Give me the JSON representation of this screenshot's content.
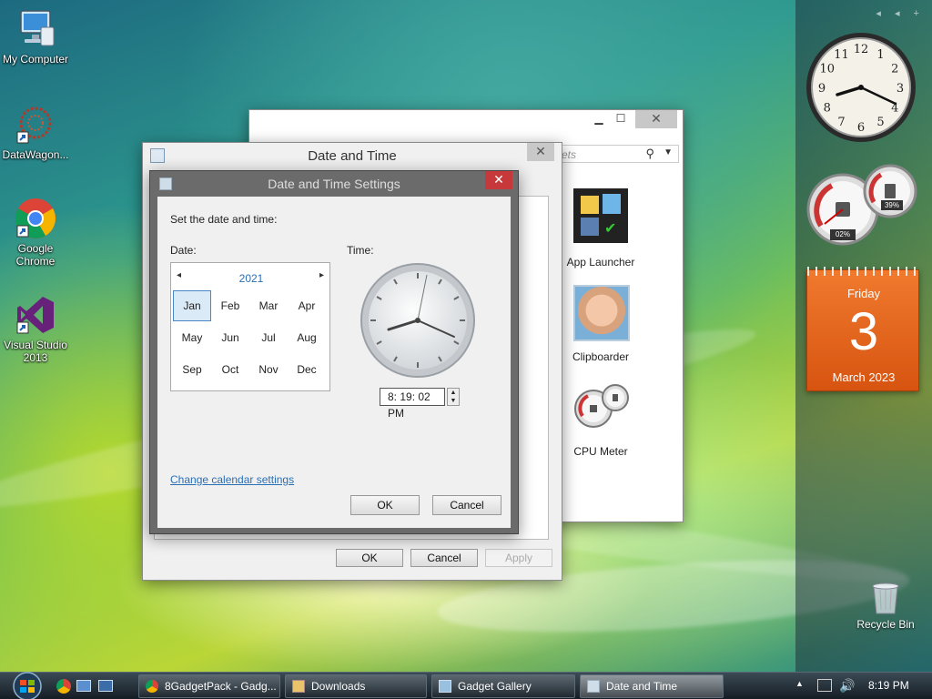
{
  "desktop": {
    "icons": [
      {
        "label": "My Computer"
      },
      {
        "label": "DataWagon..."
      },
      {
        "label": "Google Chrome"
      },
      {
        "label": "Visual Studio 2013"
      },
      {
        "label": "Recycle Bin"
      }
    ]
  },
  "sidebar": {
    "arrows": "◂ ◂ +",
    "clock_numbers": [
      "12",
      "1",
      "2",
      "3",
      "4",
      "5",
      "6",
      "7",
      "8",
      "9",
      "10",
      "11"
    ],
    "cpu_meter": {
      "cpu_value": "02%",
      "mem_value": "39%"
    },
    "calendar": {
      "weekday": "Friday",
      "day": "3",
      "month_year": "March 2023"
    }
  },
  "gadget_window": {
    "search_placeholder": "ets",
    "gadgets": [
      {
        "label": "App Launcher"
      },
      {
        "label": "Clipboarder"
      },
      {
        "label": "CPU Meter"
      }
    ]
  },
  "date_time_window": {
    "title": "Date and Time",
    "buttons": {
      "ok": "OK",
      "cancel": "Cancel",
      "apply": "Apply"
    }
  },
  "settings_dialog": {
    "title": "Date and Time Settings",
    "instruction": "Set the date and time:",
    "date_label": "Date:",
    "time_label": "Time:",
    "year": "2021",
    "prev_arrow": "◂",
    "next_arrow": "▸",
    "months": [
      "Jan",
      "Feb",
      "Mar",
      "Apr",
      "May",
      "Jun",
      "Jul",
      "Aug",
      "Sep",
      "Oct",
      "Nov",
      "Dec"
    ],
    "selected_month": "Jan",
    "time_value": "8: 19: 02 PM",
    "change_calendar_link": "Change calendar settings",
    "ok_label": "OK",
    "cancel_label": "Cancel"
  },
  "taskbar": {
    "tasks": [
      {
        "label": "8GadgetPack - Gadg..."
      },
      {
        "label": "Downloads"
      },
      {
        "label": "Gadget Gallery"
      },
      {
        "label": "Date and Time"
      }
    ],
    "clock": "8:19 PM"
  },
  "colors": {
    "accent": "#2a6fb5",
    "calendar_orange": "#e8641a",
    "close_red": "#c7383a"
  }
}
